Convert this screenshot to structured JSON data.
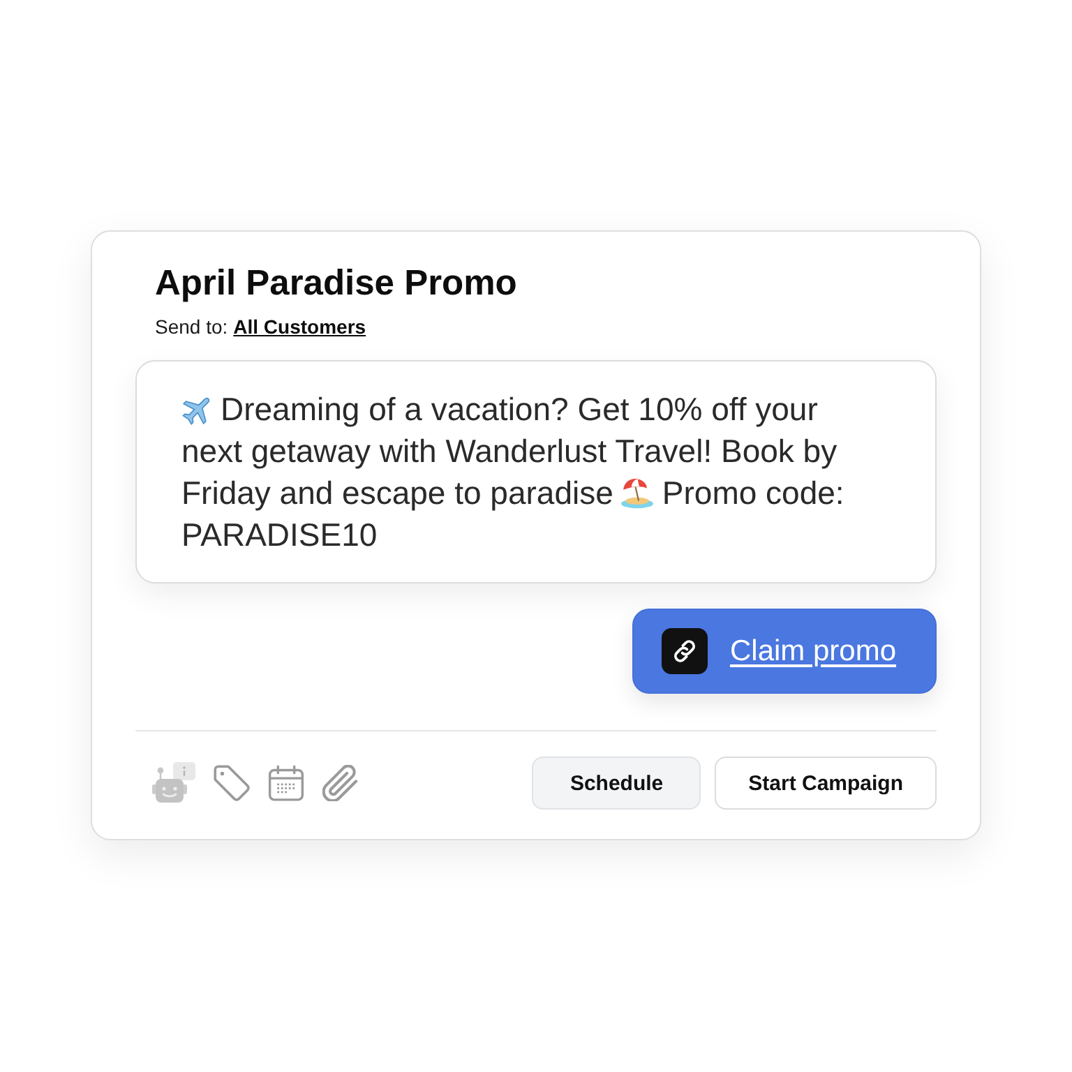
{
  "campaign": {
    "title": "April Paradise Promo",
    "send_to_label": "Send to:",
    "send_to_value": "All Customers"
  },
  "message": {
    "lines": [
      [
        {
          "kind": "emoji"
        },
        {
          "kind": "text",
          "text": "Dreaming of a vacation? Get 10% off your"
        }
      ],
      [
        {
          "kind": "text",
          "text": "next getaway with Wanderlust Travel! Book by"
        }
      ],
      [
        {
          "kind": "text",
          "text": "Friday and escape to paradise"
        },
        {
          "kind": "emoji"
        },
        {
          "kind": "text",
          "text": "Promo code:"
        }
      ],
      [
        {
          "kind": "text",
          "text": "PARADISE10"
        }
      ]
    ]
  },
  "link_button": {
    "label": "Claim promo"
  },
  "actions": [
    {
      "label": "Schedule",
      "kind": "secondary"
    },
    {
      "label": "Start Campaign",
      "kind": "outline"
    }
  ]
}
